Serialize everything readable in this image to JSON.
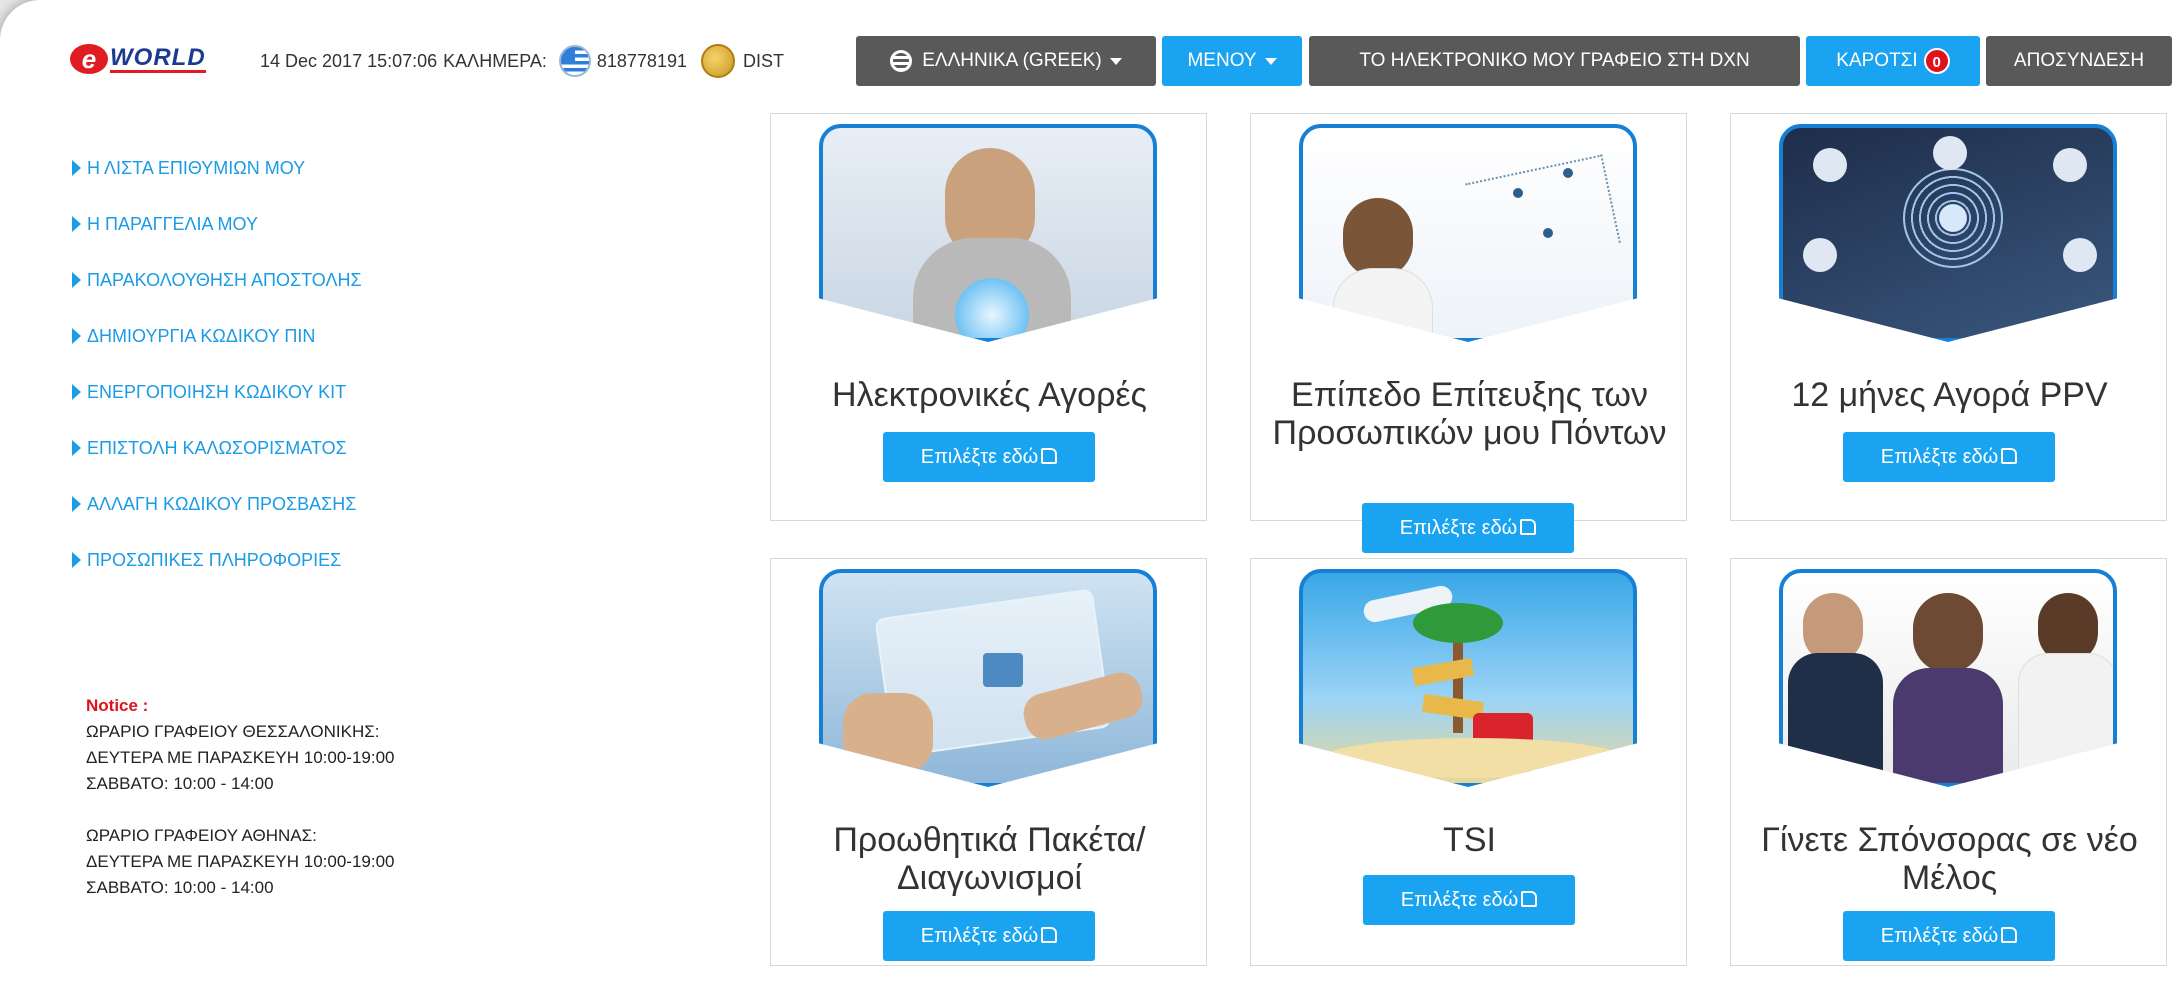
{
  "header": {
    "logo_text": "WORLD",
    "datetime": "14 Dec 2017 15:07:06",
    "greeting": "ΚΑΛΗΜΕΡΑ:",
    "member_id": "818778191",
    "rank": "DIST",
    "language_label": "ΕΛΛΗΝΙΚΑ (GREEK)",
    "menu_label": "ΜΕΝΟΥ",
    "office_label": "ΤΟ ΗΛΕΚΤΡΟΝΙΚΟ ΜΟΥ ΓΡΑΦΕΙΟ ΣΤΗ DXN",
    "cart_label": "ΚΑΡΟΤΣΙ",
    "cart_count": "0",
    "logout_label": "ΑΠΟΣΥΝΔΕΣΗ"
  },
  "sidebar": {
    "items": [
      {
        "label": "Η ΛΙΣΤΑ ΕΠΙΘΥΜΙΩΝ ΜΟΥ"
      },
      {
        "label": "Η ΠΑΡΑΓΓΕΛΙΑ ΜΟΥ"
      },
      {
        "label": "ΠΑΡΑΚΟΛΟΥΘΗΣΗ ΑΠΟΣΤΟΛΗΣ"
      },
      {
        "label": "ΔΗΜΙΟΥΡΓΙΑ ΚΩΔΙΚΟΥ ΠΙΝ"
      },
      {
        "label": "ΕΝΕΡΓΟΠΟΙΗΣΗ ΚΩΔΙΚΟΥ ΚΙΤ"
      },
      {
        "label": "ΕΠΙΣΤΟΛΗ ΚΑΛΩΣΟΡΙΣΜΑΤΟΣ"
      },
      {
        "label": "ΑΛΛΑΓΗ ΚΩΔΙΚΟΥ ΠΡΟΣΒΑΣΗΣ"
      },
      {
        "label": "ΠΡΟΣΩΠΙΚΕΣ ΠΛΗΡΟΦΟΡΙΕΣ"
      }
    ]
  },
  "notice": {
    "title": "Notice :",
    "lines": [
      "ΩΡΑΡΙΟ ΓΡΑΦΕΙΟΥ ΘΕΣΣΑΛΟΝΙΚΗΣ:",
      "ΔΕΥΤΕΡΑ ΜΕ ΠΑΡΑΣΚΕΥΗ 10:00-19:00",
      "ΣΑΒΒΑΤΟ: 10:00 - 14:00",
      "ΩΡΑΡΙΟ ΓΡΑΦΕΙΟΥ ΑΘΗΝΑΣ:",
      "ΔΕΥΤΕΡΑ ΜΕ ΠΑΡΑΣΚΕΥΗ 10:00-19:00",
      "ΣΑΒΒΑΤΟ: 10:00 - 14:00"
    ]
  },
  "cards": [
    {
      "title": "Ηλεκτρονικές Αγορές",
      "button": "Επιλέξτε εδώ"
    },
    {
      "title": "Επίπεδο Επίτευξης των Προσωπικών μου Πόντων",
      "button": "Επιλέξτε εδώ"
    },
    {
      "title": "12 μήνες Αγορά PPV",
      "button": "Επιλέξτε εδώ"
    },
    {
      "title": "Προωθητικά Πακέτα/ Διαγωνισμοί",
      "button": "Επιλέξτε εδώ"
    },
    {
      "title": "TSI",
      "button": "Επιλέξτε εδώ"
    },
    {
      "title": "Γίνετε Σπόνσορας σε νέο Μέλος",
      "button": "Επιλέξτε εδώ"
    }
  ],
  "colors": {
    "accent": "#1aa3f0",
    "dark_button": "#595959",
    "link": "#1a9be6",
    "notice_title": "#e0121b"
  }
}
